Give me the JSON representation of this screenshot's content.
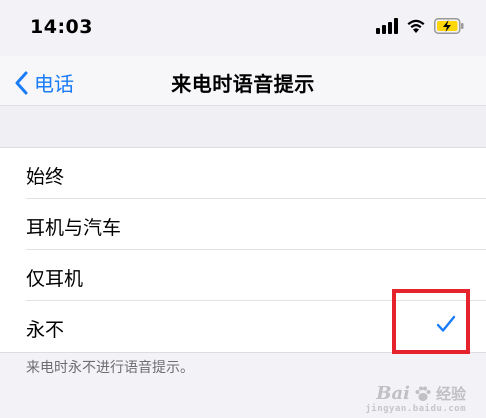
{
  "status_bar": {
    "time": "14:03",
    "icons": [
      "cellular-signal-icon",
      "wifi-icon",
      "battery-charging-icon"
    ],
    "battery_color": "#ffd60a"
  },
  "nav": {
    "back_label": "电话",
    "title": "来电时语音提示"
  },
  "options": [
    {
      "label": "始终",
      "selected": false
    },
    {
      "label": "耳机与汽车",
      "selected": false
    },
    {
      "label": "仅耳机",
      "selected": false
    },
    {
      "label": "永不",
      "selected": true
    }
  ],
  "footer_note": "来电时永不进行语音提示。",
  "colors": {
    "accent": "#1a7cf6",
    "highlight": "#e4232d"
  },
  "watermark": {
    "brand": "Bai",
    "brand_cn": "经验",
    "sub": "jingyan.baidu.com"
  }
}
